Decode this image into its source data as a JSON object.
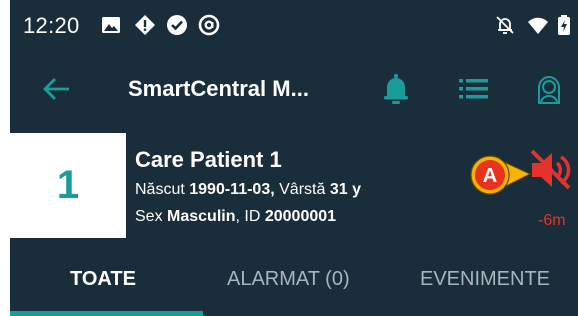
{
  "status_bar": {
    "time": "12:20",
    "icons": [
      "image-icon",
      "diamond-alert-icon",
      "check-circle-icon",
      "at-icon",
      "muted-bell-icon",
      "wifi-icon",
      "battery-charging-icon"
    ]
  },
  "app_bar": {
    "title": "SmartCentral M...",
    "icons": [
      "back-arrow-icon",
      "bell-icon",
      "list-icon",
      "user-icon"
    ]
  },
  "patient": {
    "bed_number": "1",
    "name": "Care Patient 1",
    "born_label": "Născut",
    "birth_date": "1990-11-03",
    "age_label": "Vârstă",
    "age": "31 y",
    "sex_label": "Sex",
    "sex": "Masculin",
    "id_label": "ID",
    "id": "20000001"
  },
  "alarm": {
    "icon": "muted-speaker-icon",
    "time": "-6m",
    "callout_label": "A"
  },
  "tabs": [
    {
      "label": "TOATE",
      "active": true
    },
    {
      "label": "ALARMAT (0)",
      "active": false
    },
    {
      "label": "EVENIMENTE",
      "active": false
    }
  ],
  "colors": {
    "background": "#1a2d3b",
    "accent": "#1a9c9a",
    "alarm": "#e5322d",
    "callout": "#f5b400"
  }
}
